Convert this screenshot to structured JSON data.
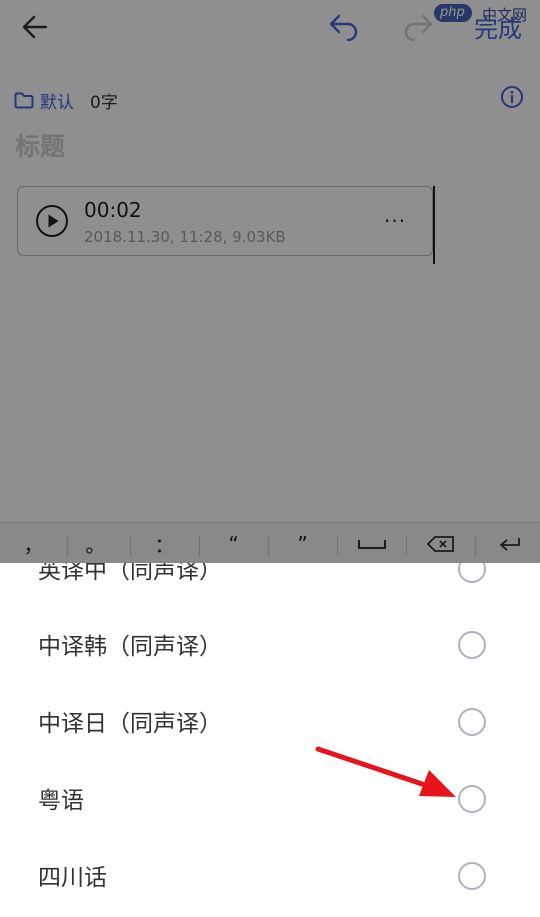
{
  "toolbar": {
    "back_icon": "arrow-left-icon",
    "undo_icon": "undo-icon",
    "redo_icon": "redo-icon",
    "done_label": "完成"
  },
  "watermark": {
    "php": "php",
    "cn": "中文网"
  },
  "note": {
    "folder_icon": "folder-icon",
    "folder_label": "默认",
    "word_count": "0字",
    "info_icon": "info-icon",
    "title_placeholder": "标题",
    "audio": {
      "duration": "00:02",
      "meta": "2018.11.30, 11:28, 9.03KB",
      "more_label": "···"
    }
  },
  "punctuation_bar": {
    "keys": [
      "，",
      "。",
      "：",
      "“",
      "”",
      "space",
      "backspace",
      "enter"
    ]
  },
  "language_options": [
    {
      "label": "英译中（同声译）",
      "selected": false
    },
    {
      "label": "中译韩（同声译）",
      "selected": false
    },
    {
      "label": "中译日（同声译）",
      "selected": false
    },
    {
      "label": "粤语",
      "selected": false
    },
    {
      "label": "四川话",
      "selected": false
    }
  ],
  "colors": {
    "accent": "#3e62d6",
    "annotation_arrow": "#e8141b",
    "radio_border": "#b0b1bb"
  }
}
